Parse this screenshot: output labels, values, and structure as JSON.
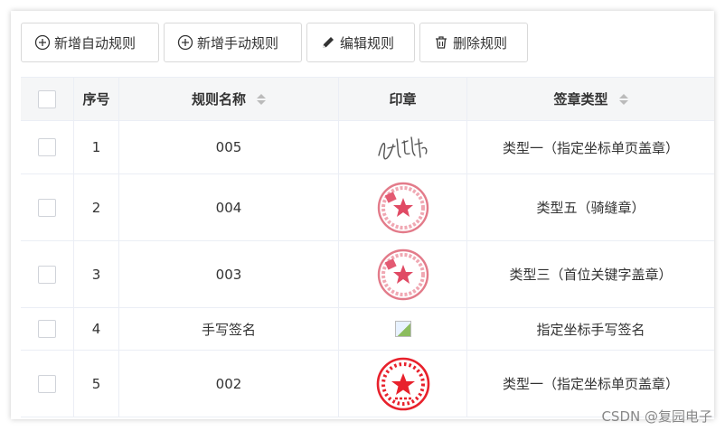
{
  "toolbar": {
    "add_auto_label": "新增自动规则",
    "add_manual_label": "新增手动规则",
    "edit_label": "编辑规则",
    "delete_label": "删除规则"
  },
  "table": {
    "headers": {
      "index": "序号",
      "name": "规则名称",
      "seal": "印章",
      "type": "签章类型"
    },
    "rows": [
      {
        "index": "1",
        "name": "005",
        "seal": "signature",
        "type": "类型一（指定坐标单页盖章）"
      },
      {
        "index": "2",
        "name": "004",
        "seal": "round-seal",
        "type": "类型五（骑缝章）"
      },
      {
        "index": "3",
        "name": "003",
        "seal": "round-seal",
        "type": "类型三（首位关键字盖章）"
      },
      {
        "index": "4",
        "name": "手写签名",
        "seal": "broken-image",
        "type": "指定坐标手写签名"
      },
      {
        "index": "5",
        "name": "002",
        "seal": "red-seal",
        "type": "类型一（指定坐标单页盖章）"
      }
    ]
  },
  "watermark": "CSDN @复园电子"
}
